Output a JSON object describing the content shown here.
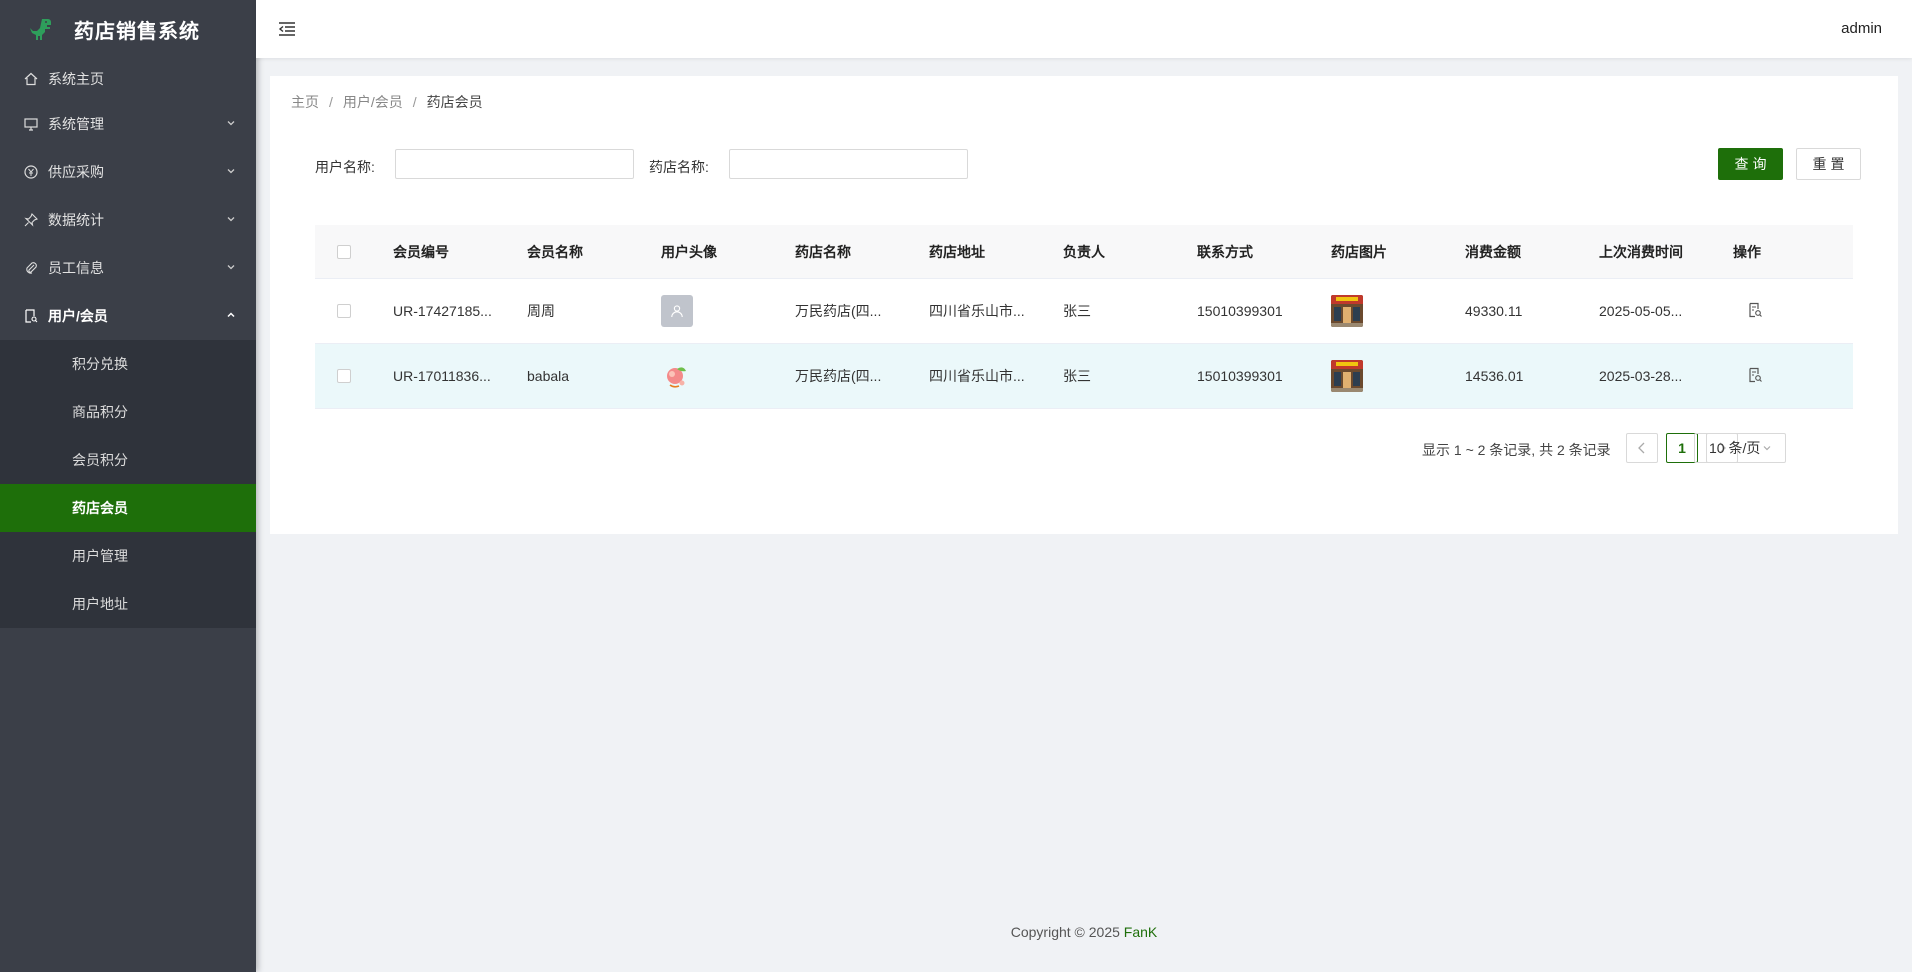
{
  "app": {
    "title": "药店销售系统",
    "user": "admin"
  },
  "sidebar": {
    "items": [
      {
        "label": "系统主页"
      },
      {
        "label": "系统管理"
      },
      {
        "label": "供应采购"
      },
      {
        "label": "数据统计"
      },
      {
        "label": "员工信息"
      },
      {
        "label": "用户/会员"
      }
    ],
    "subitems": [
      {
        "label": "积分兑换"
      },
      {
        "label": "商品积分"
      },
      {
        "label": "会员积分"
      },
      {
        "label": "药店会员"
      },
      {
        "label": "用户管理"
      },
      {
        "label": "用户地址"
      }
    ]
  },
  "breadcrumb": {
    "home": "主页",
    "parent": "用户/会员",
    "current": "药店会员"
  },
  "search": {
    "user_label": "用户名称:",
    "user_value": "",
    "store_label": "药店名称:",
    "store_value": "",
    "query_btn": "查询",
    "reset_btn": "重置"
  },
  "table": {
    "headers": [
      "会员编号",
      "会员名称",
      "用户头像",
      "药店名称",
      "药店地址",
      "负责人",
      "联系方式",
      "药店图片",
      "消费金额",
      "上次消费时间",
      "操作"
    ],
    "rows": [
      {
        "id": "UR-17427185...",
        "name": "周周",
        "store": "万民药店(四...",
        "address": "四川省乐山市...",
        "manager": "张三",
        "phone": "15010399301",
        "amount": "49330.11",
        "last": "2025-05-05..."
      },
      {
        "id": "UR-17011836...",
        "name": "babala",
        "store": "万民药店(四...",
        "address": "四川省乐山市...",
        "manager": "张三",
        "phone": "15010399301",
        "amount": "14536.01",
        "last": "2025-03-28..."
      }
    ]
  },
  "pager": {
    "total": "显示 1 ~ 2 条记录, 共 2 条记录",
    "current": "1",
    "size": "10 条/页"
  },
  "footer": {
    "copyright": "Copyright © 2025",
    "brand": "FanK"
  },
  "colors": {
    "accent": "#1e6f0a",
    "sidebar": "#3b3f48",
    "row_highlight": "#ebf8fa"
  }
}
